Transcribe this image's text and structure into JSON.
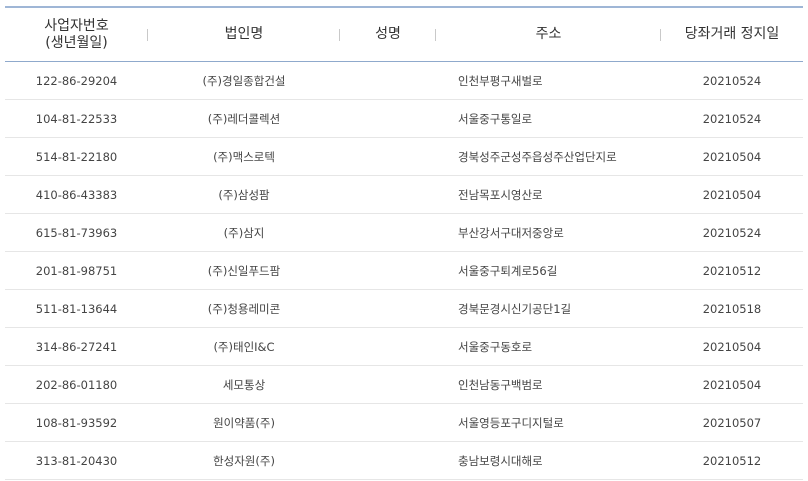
{
  "header": {
    "biz_no_line1": "사업자번호",
    "biz_no_line2": "(생년월일)",
    "corp_name": "법인명",
    "person_name": "성명",
    "address": "주소",
    "stop_date": "당좌거래 정지일"
  },
  "rows": [
    {
      "biz_no": "122-86-29204",
      "corp": "(주)경일종합건설",
      "name": "",
      "addr": "인천부평구새벌로",
      "date": "20210524"
    },
    {
      "biz_no": "104-81-22533",
      "corp": "(주)레더콜렉션",
      "name": "",
      "addr": "서울중구통일로",
      "date": "20210524"
    },
    {
      "biz_no": "514-81-22180",
      "corp": "(주)맥스로텍",
      "name": "",
      "addr": "경북성주군성주읍성주산업단지로",
      "date": "20210504"
    },
    {
      "biz_no": "410-86-43383",
      "corp": "(주)삼성팜",
      "name": "",
      "addr": "전남목포시영산로",
      "date": "20210504"
    },
    {
      "biz_no": "615-81-73963",
      "corp": "(주)삼지",
      "name": "",
      "addr": "부산강서구대저중앙로",
      "date": "20210524"
    },
    {
      "biz_no": "201-81-98751",
      "corp": "(주)신일푸드팜",
      "name": "",
      "addr": "서울중구퇴계로56길",
      "date": "20210512"
    },
    {
      "biz_no": "511-81-13644",
      "corp": "(주)청용레미콘",
      "name": "",
      "addr": "경북문경시신기공단1길",
      "date": "20210518"
    },
    {
      "biz_no": "314-86-27241",
      "corp": "(주)태인I&C",
      "name": "",
      "addr": "서울중구동호로",
      "date": "20210504"
    },
    {
      "biz_no": "202-86-01180",
      "corp": "세모통상",
      "name": "",
      "addr": "인천남동구백범로",
      "date": "20210504"
    },
    {
      "biz_no": "108-81-93592",
      "corp": "원이약품(주)",
      "name": "",
      "addr": "서울영등포구디지털로",
      "date": "20210507"
    },
    {
      "biz_no": "313-81-20430",
      "corp": "한성자원(주)",
      "name": "",
      "addr": "충남보령시대해로",
      "date": "20210512"
    }
  ]
}
